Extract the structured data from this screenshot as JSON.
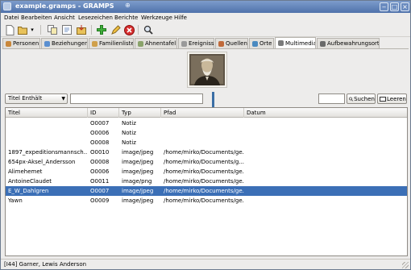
{
  "window": {
    "title": "example.gramps - GRAMPS"
  },
  "menu": [
    "Datei",
    "Bearbeiten",
    "Ansicht",
    "Lesezeichen",
    "Berichte",
    "Werkzeuge",
    "Hilfe"
  ],
  "toolbar": {
    "icons": [
      "new-icon",
      "open-icon",
      "open-dropdown-icon",
      "copy-icon",
      "properties-icon",
      "export-icon",
      "add-icon",
      "edit-icon",
      "remove-icon",
      "search-icon"
    ]
  },
  "tabs": [
    {
      "label": "Personen",
      "color": "#c9873a"
    },
    {
      "label": "Beziehungen",
      "color": "#5a8fd0"
    },
    {
      "label": "Familienliste",
      "color": "#d0a04a"
    },
    {
      "label": "Ahnentafel",
      "color": "#8aa36a"
    },
    {
      "label": "Ereignisse",
      "color": "#9a9a9a"
    },
    {
      "label": "Quellen",
      "color": "#c06a3a"
    },
    {
      "label": "Orte",
      "color": "#4a8ac0"
    },
    {
      "label": "Multimedia",
      "color": "#7a7a7a"
    },
    {
      "label": "Aufbewahrungsorte",
      "color": "#6a6a6a"
    }
  ],
  "active_tab": "Multimedia",
  "filter": {
    "select_value": "Titel Enthält",
    "input_value": "",
    "find_label": "Suchen",
    "clear_label": "Leeren"
  },
  "table": {
    "headers": [
      "Titel",
      "ID",
      "Typ",
      "Pfad",
      "Datum"
    ],
    "rows": [
      {
        "title": "",
        "id": "O0007",
        "type": "Notiz",
        "path": "",
        "date": ""
      },
      {
        "title": "",
        "id": "O0006",
        "type": "Notiz",
        "path": "",
        "date": ""
      },
      {
        "title": "",
        "id": "O0008",
        "type": "Notiz",
        "path": "",
        "date": ""
      },
      {
        "title": "1897_expeditionsmannsch...",
        "id": "O0010",
        "type": "image/jpeg",
        "path": "/home/mirko/Documents/ge...",
        "date": ""
      },
      {
        "title": "654px-Aksel_Andersson",
        "id": "O0008",
        "type": "image/jpeg",
        "path": "/home/mirko/Documents/g...",
        "date": ""
      },
      {
        "title": "Alimehemet",
        "id": "O0006",
        "type": "image/jpeg",
        "path": "/home/mirko/Documents/ge...",
        "date": ""
      },
      {
        "title": "AntoineClaudet",
        "id": "O0011",
        "type": "image/png",
        "path": "/home/mirko/Documents/ge...",
        "date": ""
      },
      {
        "title": "E_W_Dahlgren",
        "id": "O0007",
        "type": "image/jpeg",
        "path": "/home/mirko/Documents/ge...",
        "date": ""
      },
      {
        "title": "Yawn",
        "id": "O0009",
        "type": "image/jpeg",
        "path": "/home/mirko/Documents/ge...",
        "date": ""
      }
    ],
    "selected_index": 7
  },
  "status": {
    "text": "[I44] Garner, Lewis Anderson"
  }
}
